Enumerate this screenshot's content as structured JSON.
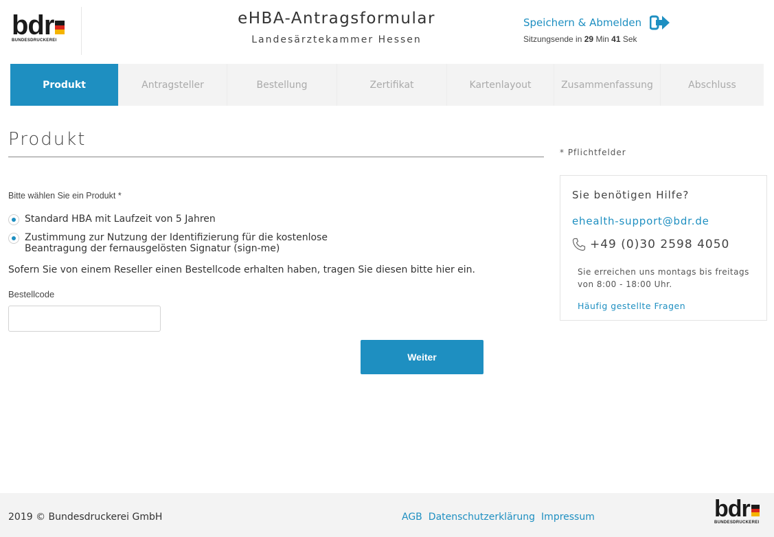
{
  "header": {
    "logo_text": "bdr",
    "logo_sub": "BUNDESDRUCKEREI",
    "title": "eHBA-Antragsformular",
    "subtitle": "Landesärztekammer Hessen",
    "logout_label": "Speichern & Abmelden",
    "session_prefix": "Sitzungsende in",
    "session_minutes": "29",
    "session_min_unit": "Min",
    "session_seconds": "41",
    "session_sec_unit": "Sek"
  },
  "nav": {
    "tabs": [
      {
        "label": "Produkt",
        "active": true
      },
      {
        "label": "Antragsteller",
        "active": false
      },
      {
        "label": "Bestellung",
        "active": false
      },
      {
        "label": "Zertifikat",
        "active": false
      },
      {
        "label": "Kartenlayout",
        "active": false
      },
      {
        "label": "Zusammenfassung",
        "active": false
      },
      {
        "label": "Abschluss",
        "active": false
      }
    ]
  },
  "main": {
    "title": "Produkt",
    "required_note": "* Pflichtfelder",
    "prompt": "Bitte wählen Sie ein Produkt *",
    "options": [
      {
        "line1": "Standard HBA mit Laufzeit von 5 Jahren",
        "line2": ""
      },
      {
        "line1": "Zustimmung zur Nutzung der Identifizierung für die kostenlose",
        "line2": "Beantragung der fernausgelösten Signatur (sign-me)"
      }
    ],
    "reseller_note": "Sofern Sie von einem Reseller einen Bestellcode erhalten haben, tragen Sie diesen bitte hier ein.",
    "order_code_label": "Bestellcode",
    "order_code_value": "",
    "next_button": "Weiter"
  },
  "help": {
    "title": "Sie benötigen Hilfe?",
    "email": "ehealth-support@bdr.de",
    "phone": "+49 (0)30 2598 4050",
    "hours": "Sie erreichen uns montags bis freitags von 8:00 - 18:00 Uhr.",
    "faq_link": "Häufig gestellte Fragen"
  },
  "footer": {
    "copyright": "2019 © Bundesdruckerei GmbH",
    "links": [
      "AGB",
      "Datenschutzerklärung",
      "Impressum"
    ]
  },
  "colors": {
    "accent": "#1e8fc1",
    "flag_black": "#1a1a1a",
    "flag_red": "#d9261c",
    "flag_gold": "#f5b400"
  },
  "icons": {
    "logout": "sign-out-arrow-icon",
    "phone": "phone-icon",
    "radio": "radio-selected-icon"
  }
}
